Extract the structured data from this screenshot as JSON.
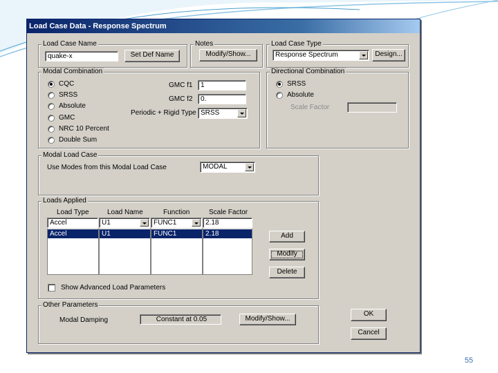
{
  "dialog": {
    "title": "Load Case Data - Response Spectrum"
  },
  "load_case_name": {
    "legend": "Load Case Name",
    "value": "quake-x",
    "set_def_name_button": "Set Def Name"
  },
  "notes": {
    "legend": "Notes",
    "modify_show_button": "Modify/Show..."
  },
  "load_case_type": {
    "legend": "Load Case Type",
    "selected": "Response Spectrum",
    "design_button": "Design..."
  },
  "modal_combination": {
    "legend": "Modal Combination",
    "options": [
      "CQC",
      "SRSS",
      "Absolute",
      "GMC",
      "NRC 10 Percent",
      "Double Sum"
    ],
    "selected": "CQC",
    "gmc_f1_label": "GMC  f1",
    "gmc_f1_value": "1",
    "gmc_f2_label": "GMC  f2",
    "gmc_f2_value": "0.",
    "periodic_label": "Periodic + Rigid Type",
    "periodic_value": "SRSS"
  },
  "directional_combination": {
    "legend": "Directional Combination",
    "options": [
      "SRSS",
      "Absolute"
    ],
    "selected": "SRSS",
    "scale_factor_label": "Scale Factor",
    "scale_factor_value": ""
  },
  "modal_load_case": {
    "legend": "Modal Load Case",
    "label": "Use Modes from this Modal Load Case",
    "value": "MODAL"
  },
  "loads_applied": {
    "legend": "Loads Applied",
    "columns": [
      "Load Type",
      "Load Name",
      "Function",
      "Scale Factor"
    ],
    "edit_row": [
      "Accel",
      "U1",
      "FUNC1",
      "2.18"
    ],
    "rows": [
      [
        "Accel",
        "U1",
        "FUNC1",
        "2.18"
      ]
    ],
    "add_button": "Add",
    "modify_button": "Modify",
    "delete_button": "Delete",
    "show_advanced_label": "Show Advanced Load Parameters",
    "show_advanced_checked": false
  },
  "other_parameters": {
    "legend": "Other Parameters",
    "modal_damping_label": "Modal Damping",
    "modal_damping_value": "Constant at 0.05",
    "modify_show_button": "Modify/Show..."
  },
  "ok_button": "OK",
  "cancel_button": "Cancel",
  "slide": {
    "page_number": "55"
  },
  "colors": {
    "title_bar": "#0a246a",
    "dialog_face": "#d4d0c8",
    "selection": "#0a246a",
    "page_number": "#3a6fb0"
  }
}
